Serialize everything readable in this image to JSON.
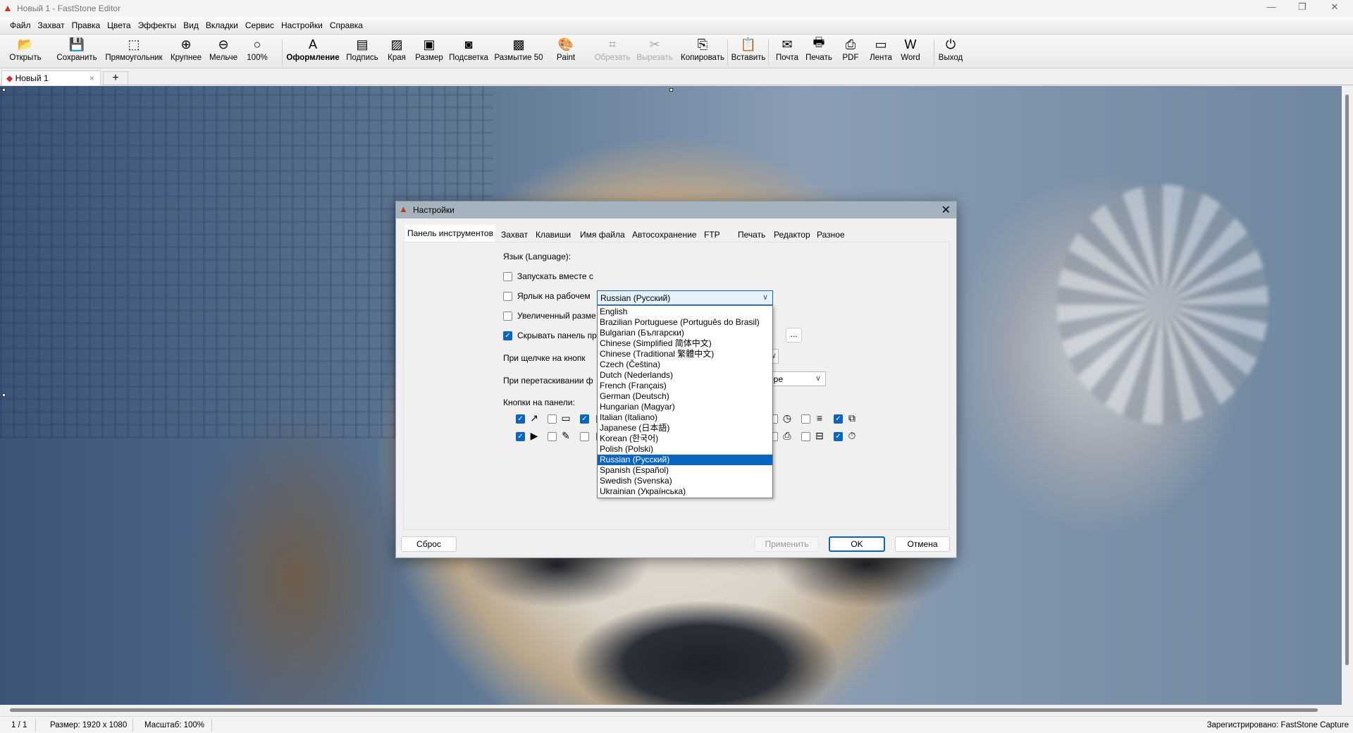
{
  "window": {
    "title": "Новый 1 - FastStone Editor",
    "min": "—",
    "max": "❐",
    "close": "✕"
  },
  "menu": [
    "Файл",
    "Захват",
    "Правка",
    "Цвета",
    "Эффекты",
    "Вид",
    "Вкладки",
    "Сервис",
    "Настройки",
    "Справка"
  ],
  "toolbar": [
    {
      "label": "Открыть",
      "icon": "open-folder-icon",
      "glyph": "📂"
    },
    {
      "label": "Сохранить",
      "icon": "save-icon",
      "glyph": "💾"
    },
    {
      "label": "Прямоугольник",
      "icon": "rectangle-select-icon",
      "glyph": "⬚"
    },
    {
      "label": "Крупнее",
      "icon": "zoom-in-icon",
      "glyph": "⊕"
    },
    {
      "label": "Мельче",
      "icon": "zoom-out-icon",
      "glyph": "⊖"
    },
    {
      "label": "100%",
      "icon": "zoom-100-icon",
      "glyph": "○"
    },
    {
      "label": "Оформление",
      "icon": "draw-icon",
      "glyph": "A"
    },
    {
      "label": "Подпись",
      "icon": "caption-icon",
      "glyph": "▤"
    },
    {
      "label": "Края",
      "icon": "edges-icon",
      "glyph": "▨"
    },
    {
      "label": "Размер",
      "icon": "resize-icon",
      "glyph": "▣"
    },
    {
      "label": "Подсветка",
      "icon": "spotlight-icon",
      "glyph": "◙"
    },
    {
      "label": "Размытие 50",
      "icon": "blur-icon",
      "glyph": "▩"
    },
    {
      "label": "Paint",
      "icon": "paint-palette-icon",
      "glyph": "🎨"
    },
    {
      "label": "Обрезать",
      "icon": "crop-icon",
      "glyph": "⌗",
      "disabled": true
    },
    {
      "label": "Вырезать",
      "icon": "cut-icon",
      "glyph": "✂",
      "disabled": true
    },
    {
      "label": "Копировать",
      "icon": "copy-icon",
      "glyph": "⎘"
    },
    {
      "label": "Вставить",
      "icon": "paste-icon",
      "glyph": "📋"
    },
    {
      "label": "Почта",
      "icon": "mail-icon",
      "glyph": "✉"
    },
    {
      "label": "Печать",
      "icon": "print-icon",
      "glyph": "🖶"
    },
    {
      "label": "PDF",
      "icon": "pdf-icon",
      "glyph": "⎙"
    },
    {
      "label": "Лента",
      "icon": "film-strip-icon",
      "glyph": "▭"
    },
    {
      "label": "Word",
      "icon": "word-icon",
      "glyph": "W"
    },
    {
      "label": "Выход",
      "icon": "power-icon",
      "glyph": "⏻"
    }
  ],
  "tabs": {
    "doc": "Новый 1",
    "close": "×",
    "new": "+"
  },
  "status": {
    "page": "1 / 1",
    "size": "Размер: 1920 x 1080",
    "zoom": "Масштаб: 100%",
    "registered": "Зарегистрировано: FastStone Capture"
  },
  "dialog": {
    "title": "Настройки",
    "close": "✕",
    "tabs": [
      "Панель инструментов",
      "Захват",
      "Клавиши",
      "Имя файла",
      "Автосохранение",
      "FTP",
      "Печать",
      "Редактор",
      "Разное"
    ],
    "active_tab": 0,
    "language_label": "Язык (Language):",
    "language_value": "Russian (Русский)",
    "languages": [
      "English",
      "Brazilian Portuguese (Português do Brasil)",
      "Bulgarian (Български)",
      "Chinese (Simplified 简体中文)",
      "Chinese (Traditional 繁體中文)",
      "Czech (Čeština)",
      "Dutch (Nederlands)",
      "French (Français)",
      "German (Deutsch)",
      "Hungarian (Magyar)",
      "Italian (Italiano)",
      "Japanese (日本語)",
      "Korean (한국어)",
      "Polish (Polski)",
      "Russian (Русский)",
      "Spanish (Español)",
      "Swedish (Svenska)",
      "Ukrainian (Українська)"
    ],
    "selected_language_index": 14,
    "options": [
      {
        "label": "Запускать вместе с",
        "checked": false
      },
      {
        "label": "Ярлык на рабочем",
        "checked": false
      },
      {
        "label": "Увеличенный разме",
        "checked": false
      },
      {
        "label": "Скрывать панель пр",
        "checked": true
      }
    ],
    "click_label": "При щелчке на кнопк",
    "drag_label": "При перетаскивании ф",
    "drag_value": "ope",
    "more_button": "...",
    "buttons_label": "Кнопки на панели:",
    "reset": "Сброс",
    "apply": "Применить",
    "ok": "OK",
    "cancel": "Отмена"
  }
}
